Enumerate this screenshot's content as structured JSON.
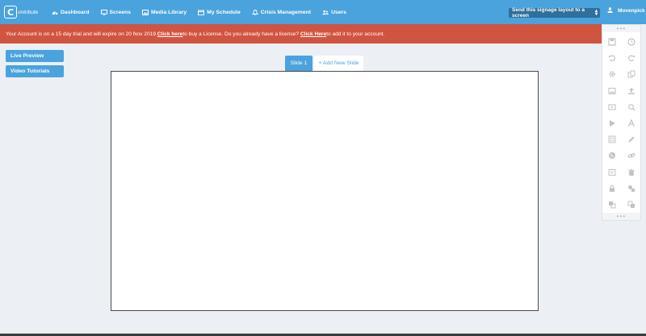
{
  "logo": {
    "mark": "C",
    "text": "ontribute"
  },
  "nav": [
    {
      "label": "Dashboard",
      "icon": "dashboard-icon"
    },
    {
      "label": "Screens",
      "icon": "monitor-icon"
    },
    {
      "label": "Media Library",
      "icon": "image-icon"
    },
    {
      "label": "My Schedule",
      "icon": "calendar-icon"
    },
    {
      "label": "Crisis Management",
      "icon": "bell-icon"
    },
    {
      "label": "Users",
      "icon": "users-icon"
    }
  ],
  "send_select": {
    "value": "Send this signage layout to a screen"
  },
  "user": {
    "name": "Movenpick",
    "icon": "user-icon"
  },
  "banner": {
    "text1": "Your Account is on a 15 day trial and will expire on 20 Nov 2019. ",
    "link1": "Click here",
    "text2": " to buy a License. Do you already have a license? ",
    "link2": "Click Here",
    "text3": " to add it to your account."
  },
  "side_buttons": {
    "live_preview": "Live Preview",
    "video_tutorials": "Video Tutorials"
  },
  "tabs": {
    "active": "Slide 1",
    "add": "+ Add New Slide"
  },
  "toolbar": {
    "dots": "•••",
    "tools": [
      "save-icon",
      "clock-icon",
      "undo-icon",
      "redo-icon",
      "settings-icon",
      "copy-icon",
      "image-icon",
      "upload-icon",
      "video-icon",
      "search-icon",
      "play-icon",
      "text-icon",
      "frame-icon",
      "pencil-icon",
      "globe-icon",
      "link-icon",
      "widget-icon",
      "trash-icon",
      "lock-icon",
      "shapes-icon",
      "layers-icon",
      "layers-alt-icon"
    ]
  },
  "colors": {
    "primary": "#4aa3dc",
    "banner": "#d05440",
    "background": "#eceff3"
  }
}
